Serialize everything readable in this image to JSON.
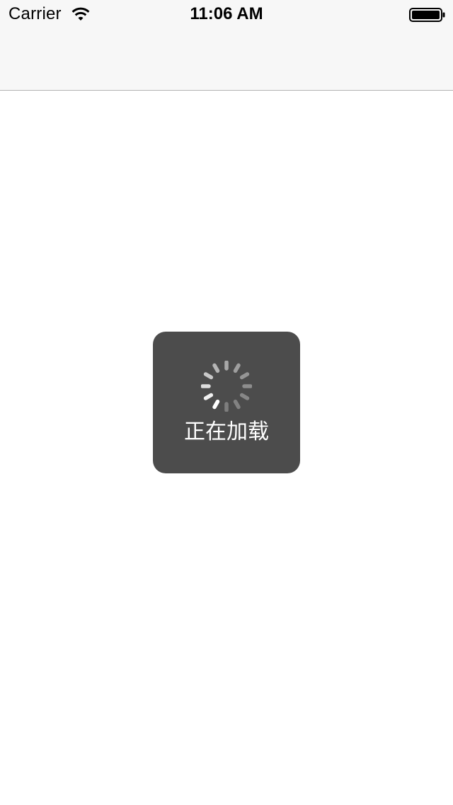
{
  "status_bar": {
    "carrier": "Carrier",
    "time": "11:06 AM",
    "wifi_icon": "wifi-icon",
    "battery_icon": "battery-full-icon"
  },
  "navigation_bar": {
    "title": ""
  },
  "loading_hud": {
    "label": "正在加载",
    "spinner_icon": "activity-spinner-icon"
  },
  "colors": {
    "nav_background": "#f7f7f7",
    "content_background": "#ffffff",
    "hud_background": "#4c4c4c",
    "hud_text": "#ffffff"
  }
}
